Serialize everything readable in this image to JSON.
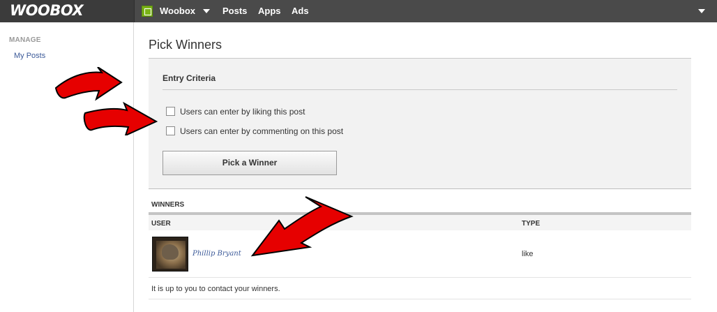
{
  "topbar": {
    "logo": "WOOBOX",
    "app_name": "Woobox",
    "nav": [
      "Posts",
      "Apps",
      "Ads"
    ]
  },
  "sidebar": {
    "heading": "MANAGE",
    "items": [
      {
        "label": "My Posts"
      }
    ]
  },
  "main": {
    "title": "Pick Winners",
    "criteria": {
      "title": "Entry Criteria",
      "options": [
        {
          "label": "Users can enter by liking this post",
          "checked": false
        },
        {
          "label": "Users can enter by commenting on this post",
          "checked": false
        }
      ],
      "button_label": "Pick a Winner"
    },
    "winners": {
      "heading": "WINNERS",
      "columns": [
        "USER",
        "TYPE"
      ],
      "rows": [
        {
          "user": "Phillip Bryant",
          "type": "like"
        }
      ],
      "footnote": "It is up to you to contact your winners."
    }
  },
  "colors": {
    "topbar": "#3b3b3b",
    "link": "#3b5998",
    "annotation_arrow": "#e60000"
  }
}
